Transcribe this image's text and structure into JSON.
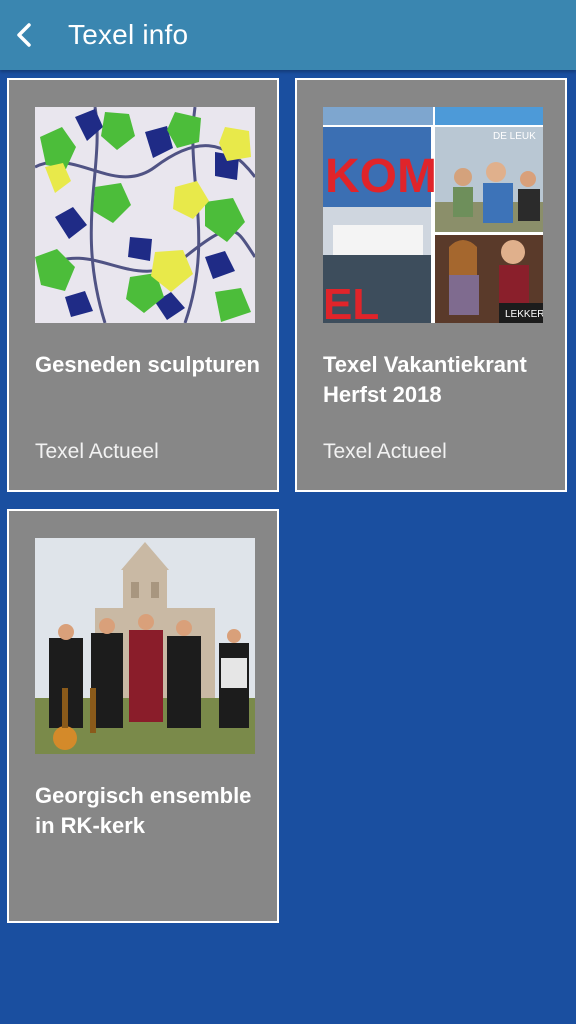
{
  "header": {
    "title": "Texel info",
    "back_icon": "chevron-left-icon"
  },
  "colors": {
    "header": "#3a86b0",
    "background": "#1a4fa0",
    "card": "#878787"
  },
  "cards": [
    {
      "title": "Gesneden sculpturen",
      "source": "Texel Actueel"
    },
    {
      "title": "Texel Vakantiekrant Herfst 2018",
      "source": "Texel Actueel"
    },
    {
      "title": "Georgisch ensemble in RK-kerk",
      "source": ""
    }
  ],
  "thumbs": {
    "ferry_word_top": "KOM",
    "ferry_word_bottom": "EL",
    "badge_top": "DE LEUK",
    "badge_bottom": "LEKKER"
  }
}
